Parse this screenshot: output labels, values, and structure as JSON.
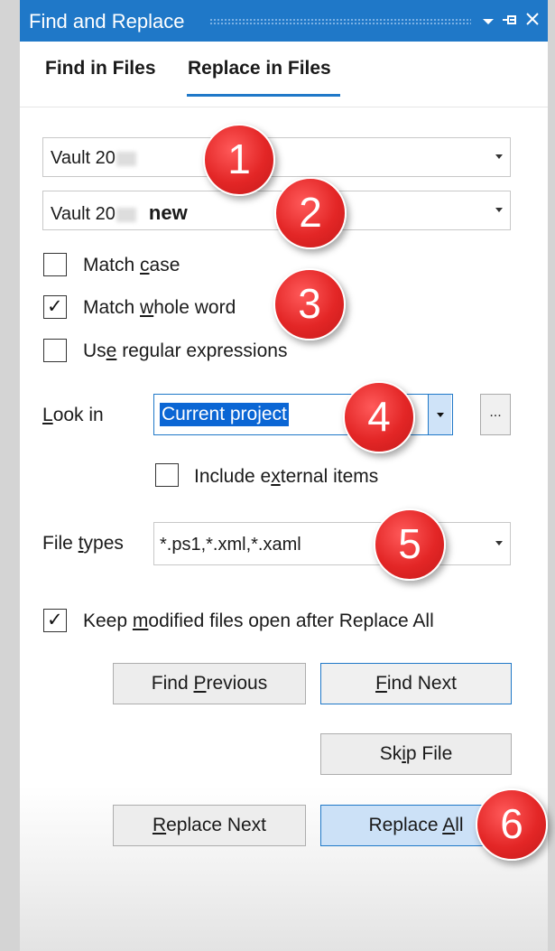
{
  "window": {
    "title": "Find and Replace",
    "icons": [
      "dropdown-icon",
      "pin-icon",
      "close-icon"
    ]
  },
  "tabs": [
    {
      "label": "Find in Files",
      "active": false
    },
    {
      "label": "Replace in Files",
      "active": true
    }
  ],
  "find": {
    "value": "Vault 20"
  },
  "replace": {
    "value": "Vault 20",
    "suffix": "new"
  },
  "options": {
    "match_case": {
      "label_pre": "Match ",
      "label_key": "c",
      "label_post": "ase",
      "checked": false
    },
    "match_whole_word": {
      "label_pre": "Match ",
      "label_key": "w",
      "label_post": "hole word",
      "checked": true
    },
    "use_regex": {
      "label_pre": "Us",
      "label_key": "e",
      "label_post": " regular expressions",
      "checked": false
    }
  },
  "look_in": {
    "label_key": "L",
    "label_post": "ook in",
    "value": "Current project",
    "browse_label": "...",
    "include_external": {
      "label_pre": "Include e",
      "label_key": "x",
      "label_post": "ternal items",
      "checked": false
    }
  },
  "file_types": {
    "label_pre": "File ",
    "label_key": "t",
    "label_post": "ypes",
    "value": "*.ps1,*.xml,*.xaml"
  },
  "keep_open": {
    "label_pre": "Keep ",
    "label_key": "m",
    "label_post": "odified files open after Replace All",
    "checked": true
  },
  "buttons": {
    "find_previous": {
      "pre": "Find ",
      "key": "P",
      "post": "revious"
    },
    "find_next": {
      "pre": "",
      "key": "F",
      "post": "ind Next"
    },
    "skip_file": {
      "pre": "Sk",
      "key": "i",
      "post": "p File"
    },
    "replace_next": {
      "pre": "",
      "key": "R",
      "post": "eplace Next"
    },
    "replace_all": {
      "pre": "Replace ",
      "key": "A",
      "post": "ll"
    }
  },
  "annotations": [
    "1",
    "2",
    "3",
    "4",
    "5",
    "6"
  ],
  "colors": {
    "accent": "#1f78c8",
    "badge": "#e32626",
    "selection": "#0b66d4"
  }
}
